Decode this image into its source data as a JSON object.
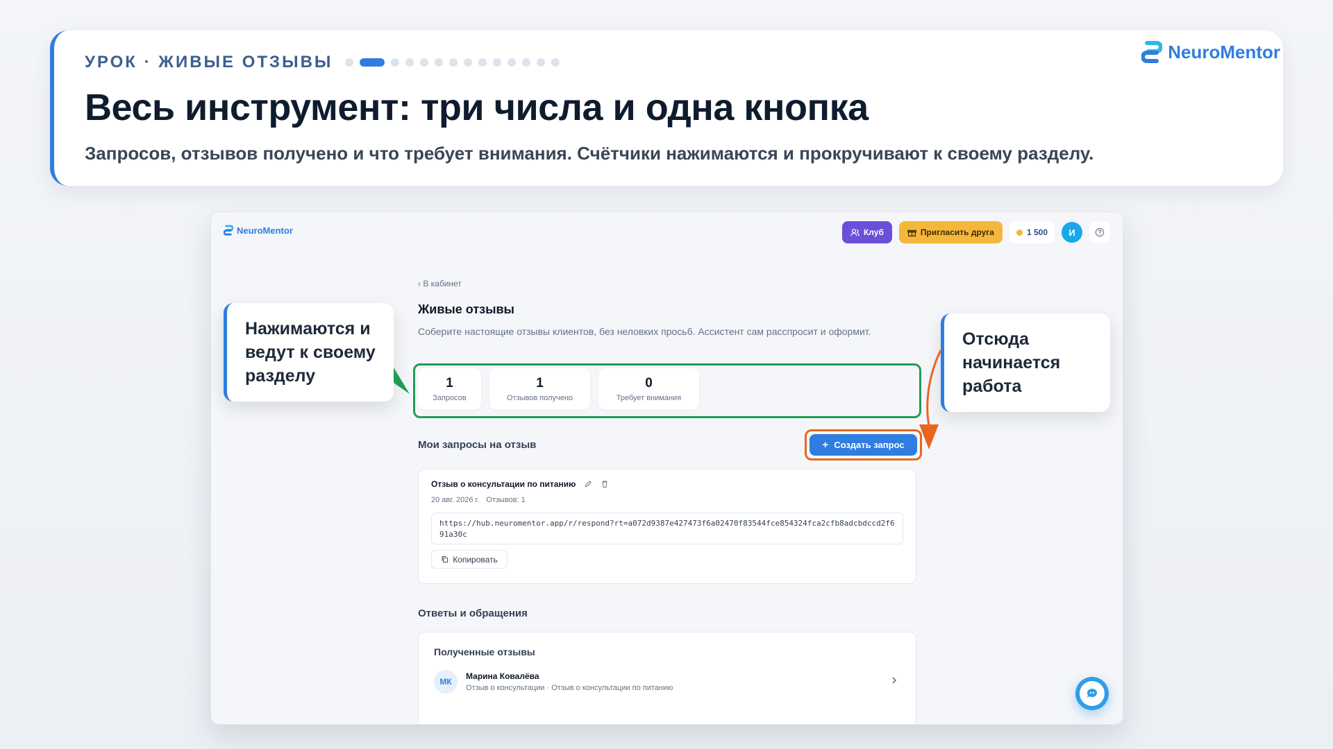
{
  "lesson": {
    "tag": "УРОК · ЖИВЫЕ ОТЗЫВЫ",
    "title": "Весь инструмент: три числа и одна кнопка",
    "subtitle": "Запросов, отзывов получено и что требует внимания. Счётчики нажимаются и прокручивают к своему разделу.",
    "brand": "NeuroMentor",
    "progress": {
      "current_step": 2,
      "total_steps": 14
    }
  },
  "colors": {
    "accent": "#2f7de1",
    "club": "#6b4fd8",
    "invite": "#f5b73b",
    "highlight_green": "#1f9d55",
    "highlight_orange": "#e8661f"
  },
  "app": {
    "brand": "NeuroMentor",
    "topbar": {
      "club_label": "Клуб",
      "invite_label": "Пригласить друга",
      "balance": "1 500",
      "avatar_initial": "И"
    },
    "back_label": "‹ В кабинет",
    "title": "Живые отзывы",
    "description": "Соберите настоящие отзывы клиентов, без неловких просьб. Ассистент сам расспросит и оформит.",
    "stats": [
      {
        "value": "1",
        "label": "Запросов"
      },
      {
        "value": "1",
        "label": "Отзывов получено"
      },
      {
        "value": "0",
        "label": "Требует внимания"
      }
    ],
    "requests_title": "Мои запросы на отзыв",
    "create_button": "Создать запрос",
    "request": {
      "title": "Отзыв о консультации по питанию",
      "date": "20 авг. 2026 г.",
      "reviews": "Отзывов: 1",
      "link": "https://hub.neuromentor.app/r/respond?rt=a072d9387e427473f6a02470f83544fce854324fca2cfb8adcbdccd2f691a30c",
      "copy_label": "Копировать"
    },
    "responses_title": "Ответы и обращения",
    "received": {
      "title": "Полученные отзывы",
      "items": [
        {
          "initials": "МК",
          "name": "Марина Ковалёва",
          "subtitle": "Отзыв о консультации · Отзыв о консультации по питанию"
        }
      ]
    }
  },
  "callouts": {
    "left": "Нажимаются и ведут к своему разделу",
    "right": "Отсюда начинается работа"
  }
}
